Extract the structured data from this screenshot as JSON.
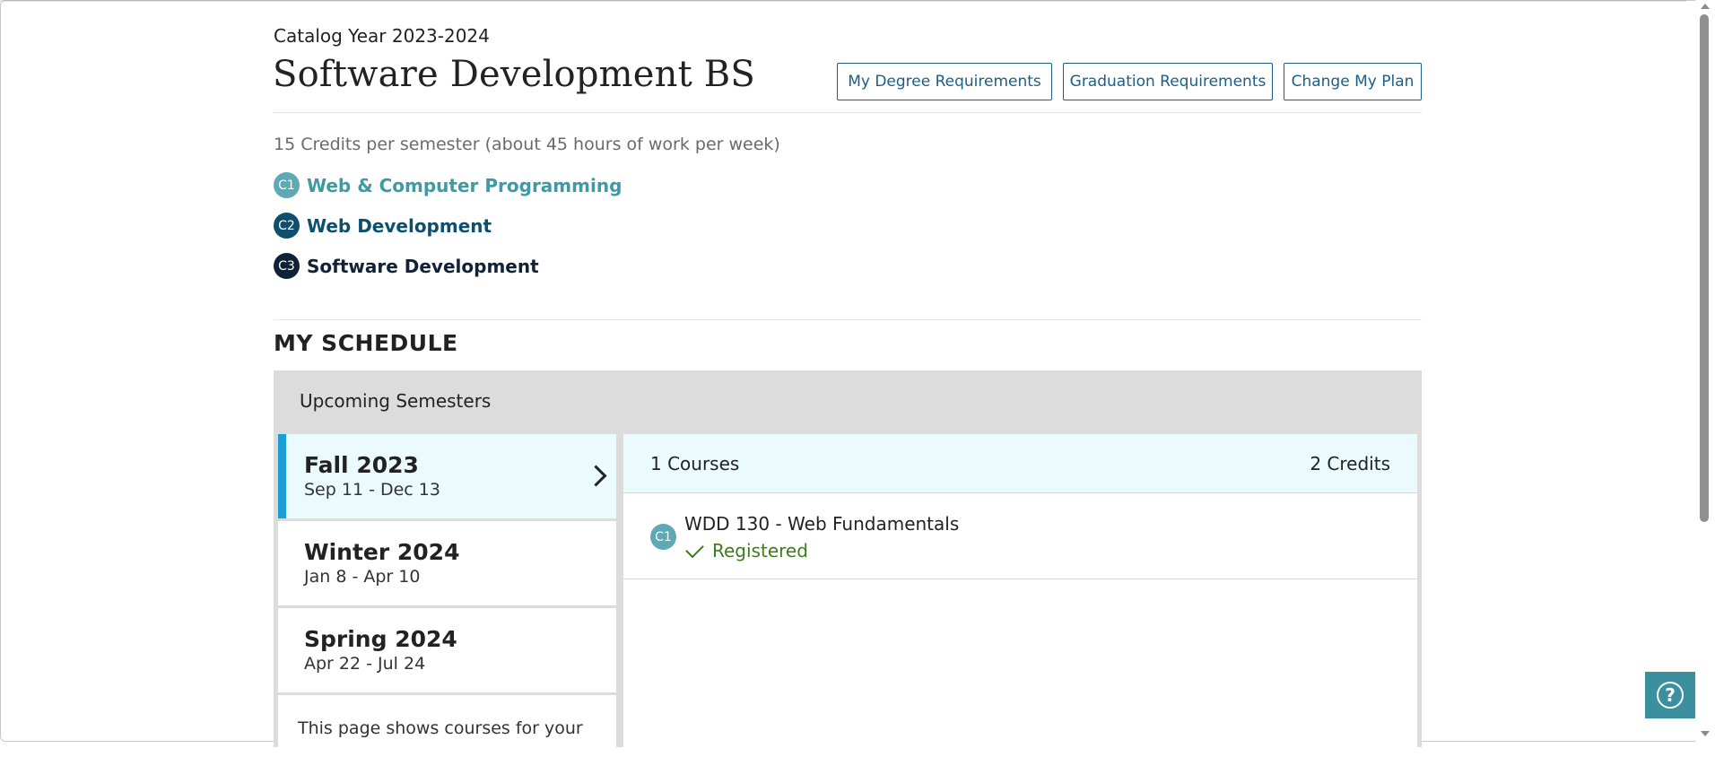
{
  "header": {
    "catalog_year": "Catalog Year 2023-2024",
    "program_title": "Software Development BS",
    "buttons": {
      "degree_requirements": "My Degree Requirements",
      "graduation_requirements": "Graduation Requirements",
      "change_plan": "Change My Plan"
    },
    "credits_note": "15 Credits per semester (about 45 hours of work per week)"
  },
  "certificates": [
    {
      "badge": "C1",
      "name": "Web & Computer Programming",
      "color": "#3f9aa6"
    },
    {
      "badge": "C2",
      "name": "Web Development",
      "color": "#0f4f6e"
    },
    {
      "badge": "C3",
      "name": "Software Development",
      "color": "#0f2238"
    }
  ],
  "schedule": {
    "title": "MY SCHEDULE",
    "panel_heading": "Upcoming Semesters",
    "semesters": [
      {
        "name": "Fall 2023",
        "dates": "Sep 11 - Dec 13",
        "selected": true
      },
      {
        "name": "Winter 2024",
        "dates": "Jan 8 - Apr 10",
        "selected": false
      },
      {
        "name": "Spring 2024",
        "dates": "Apr 22 - Jul 24",
        "selected": false
      }
    ],
    "note": "This page shows courses for your",
    "selected_summary": {
      "courses": "1 Courses",
      "credits": "2 Credits"
    },
    "courses": [
      {
        "badge": "C1",
        "title": "WDD 130 - Web Fundamentals",
        "status": "Registered"
      }
    ]
  },
  "help": {
    "icon": "question-circle-icon",
    "label": "?"
  },
  "colors": {
    "accent_blue": "#1a9fd5",
    "button_border": "#1c5f86",
    "registered_green": "#3a7d1a",
    "help_bg": "#3c8f9e"
  }
}
